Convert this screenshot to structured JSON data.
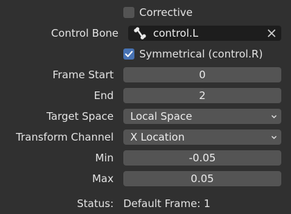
{
  "corrective": {
    "label": "Corrective",
    "checked": false
  },
  "control_bone": {
    "label": "Control Bone",
    "value": "control.L",
    "icon": "bone-icon",
    "clear_icon": "close-icon"
  },
  "symmetrical": {
    "label": "Symmetrical (control.R)",
    "checked": true
  },
  "frame_start": {
    "label": "Frame Start",
    "value": "0"
  },
  "end": {
    "label": "End",
    "value": "2"
  },
  "target_space": {
    "label": "Target Space",
    "value": "Local Space"
  },
  "transform_channel": {
    "label": "Transform Channel",
    "value": "X Location"
  },
  "min": {
    "label": "Min",
    "value": "-0.05"
  },
  "max": {
    "label": "Max",
    "value": "0.05"
  },
  "status": {
    "label": "Status:",
    "value": "Default Frame: 1"
  },
  "colors": {
    "background": "#303030",
    "field": "#545454",
    "dark_field": "#1d1d1d",
    "accent": "#4772b3"
  }
}
